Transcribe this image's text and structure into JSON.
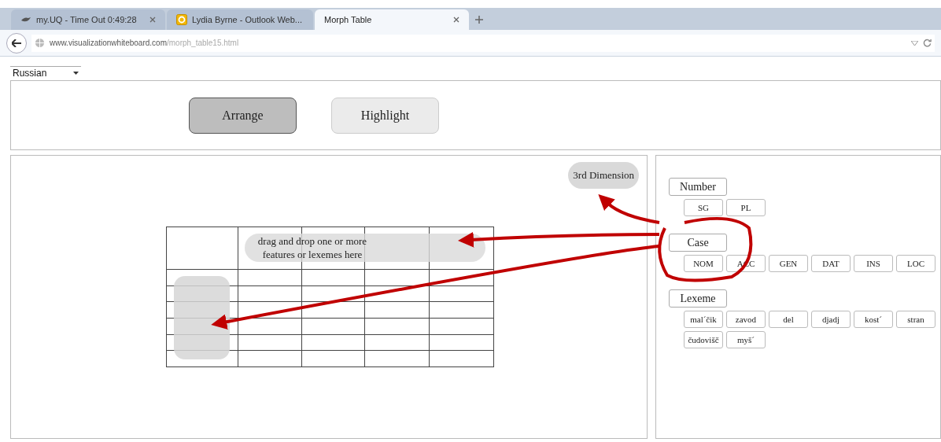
{
  "browser": {
    "tabs": [
      {
        "title": "my.UQ - Time Out 0:49:28",
        "selected": false
      },
      {
        "title": "Lydia Byrne - Outlook Web...",
        "selected": false
      },
      {
        "title": "Morph Table",
        "selected": true
      }
    ],
    "url": {
      "domain": "www.visualizationwhiteboard.com",
      "path": "/morph_table15.html"
    }
  },
  "language_select": {
    "value": "Russian"
  },
  "toolbar": [
    {
      "label": "Arrange",
      "selected": true
    },
    {
      "label": "Highlight",
      "selected": false
    }
  ],
  "third_dimension": "3rd Dimension",
  "table": {
    "drop_hint": "drag and drop one or more features or lexemes here"
  },
  "feature_groups": [
    {
      "label": "Number",
      "values": [
        "SG",
        "PL"
      ]
    },
    {
      "label": "Case",
      "values": [
        "NOM",
        "ACC",
        "GEN",
        "DAT",
        "INS",
        "LOC"
      ]
    },
    {
      "label": "Lexeme",
      "values": [
        "mal´čik",
        "zavod",
        "del",
        "djadj",
        "kost´",
        "stran",
        "čudovišč",
        "myš´"
      ]
    }
  ]
}
